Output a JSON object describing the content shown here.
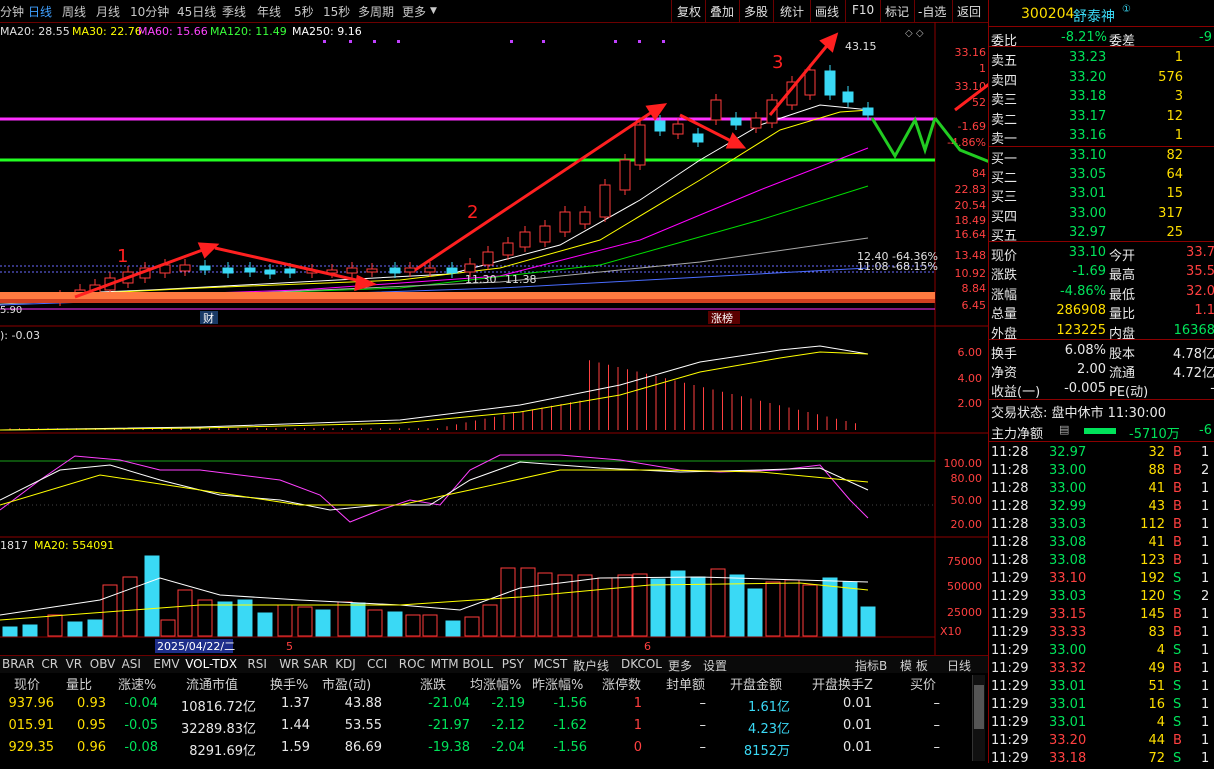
{
  "toolbar": {
    "periods": [
      "分钟",
      "日线",
      "周线",
      "月线",
      "10分钟",
      "45日线",
      "季线",
      "年线",
      "5秒",
      "15秒",
      "多周期",
      "更多"
    ],
    "selected": "日线",
    "actions": [
      "复权",
      "叠加",
      "多股",
      "统计",
      "画线",
      "F10",
      "标记",
      "-自选",
      "返回"
    ]
  },
  "ma_legend": {
    "ma20": "MA20: 28.55",
    "ma30": "MA30: 22.76",
    "ma60": "MA60: 15.66",
    "ma120": "MA120: 11.49",
    "ma250": "MA250: 9.16"
  },
  "price_axis": [
    "33.16",
    "33.10",
    "-1.69",
    "-4.86%",
    "22.83",
    "20.54",
    "18.49",
    "16.64",
    "13.48",
    "10.92",
    "8.84",
    "6.45"
  ],
  "price_axis_extra": [
    "1",
    "52",
    "84"
  ],
  "annotations": {
    "high": "43.15",
    "low": "5.90",
    "mid_low": "11.30",
    "mid_low2": "11.38",
    "pct1": "12.40 -64.36%",
    "pct2": "11.08 -68.15%",
    "label_1": "1",
    "label_2": "2",
    "label_3": "3",
    "tag_cai": "财",
    "tag_zhangbang": "涨榜"
  },
  "indicator1": {
    "label": "): -0.03",
    "axis": [
      "6.00",
      "4.00",
      "2.00"
    ]
  },
  "indicator2": {
    "axis": [
      "100.00",
      "80.00",
      "50.00",
      "20.00"
    ]
  },
  "volume": {
    "label": "1817",
    "ma20": "MA20: 554091",
    "axis": [
      "75000",
      "50000",
      "25000"
    ],
    "x10": "X10",
    "date_label": "2025/04/22/二",
    "month5": "5",
    "month6": "6"
  },
  "stock": {
    "code": "300204",
    "name": "舒泰神"
  },
  "orderbook": {
    "weibi_label": "委比",
    "weibi": "-8.21%",
    "weicha_label": "委差",
    "weicha": "-9",
    "asks": [
      {
        "label": "卖五",
        "price": "33.23",
        "vol": "1"
      },
      {
        "label": "卖四",
        "price": "33.20",
        "vol": "576"
      },
      {
        "label": "卖三",
        "price": "33.18",
        "vol": "3"
      },
      {
        "label": "卖二",
        "price": "33.17",
        "vol": "12"
      },
      {
        "label": "卖一",
        "price": "33.16",
        "vol": "1"
      }
    ],
    "bids": [
      {
        "label": "买一",
        "price": "33.10",
        "vol": "82"
      },
      {
        "label": "买二",
        "price": "33.05",
        "vol": "64"
      },
      {
        "label": "买三",
        "price": "33.01",
        "vol": "15"
      },
      {
        "label": "买四",
        "price": "33.00",
        "vol": "317"
      },
      {
        "label": "买五",
        "price": "32.97",
        "vol": "25"
      }
    ]
  },
  "quote": [
    {
      "l1": "现价",
      "v1": "33.10",
      "l2": "今开",
      "v2": "33.7"
    },
    {
      "l1": "涨跌",
      "v1": "-1.69",
      "l2": "最高",
      "v2": "35.5"
    },
    {
      "l1": "涨幅",
      "v1": "-4.86%",
      "l2": "最低",
      "v2": "32.0"
    },
    {
      "l1": "总量",
      "v1": "286908",
      "l2": "量比",
      "v2": "1.1"
    },
    {
      "l1": "外盘",
      "v1": "123225",
      "l2": "内盘",
      "v2": "16368"
    }
  ],
  "fundamentals": [
    {
      "l1": "换手",
      "v1": "6.08%",
      "l2": "股本",
      "v2": "4.78亿"
    },
    {
      "l1": "净资",
      "v1": "2.00",
      "l2": "流通",
      "v2": "4.72亿"
    },
    {
      "l1": "收益(一)",
      "v1": "-0.005",
      "l2": "PE(动)",
      "v2": "-"
    }
  ],
  "trade_status": "交易状态: 盘中休市 11:30:00",
  "main_flow": {
    "label": "主力净额",
    "value": "-5710万",
    "pct": "-6"
  },
  "ticks": [
    {
      "t": "11:28",
      "p": "32.97",
      "v": "32",
      "d": "B",
      "n": "1"
    },
    {
      "t": "11:28",
      "p": "33.00",
      "v": "88",
      "d": "B",
      "n": "2"
    },
    {
      "t": "11:28",
      "p": "33.00",
      "v": "41",
      "d": "B",
      "n": "1"
    },
    {
      "t": "11:28",
      "p": "32.99",
      "v": "43",
      "d": "B",
      "n": "1"
    },
    {
      "t": "11:28",
      "p": "33.03",
      "v": "112",
      "d": "B",
      "n": "1"
    },
    {
      "t": "11:28",
      "p": "33.08",
      "v": "41",
      "d": "B",
      "n": "1"
    },
    {
      "t": "11:28",
      "p": "33.08",
      "v": "123",
      "d": "B",
      "n": "1"
    },
    {
      "t": "11:29",
      "p": "33.10",
      "v": "192",
      "d": "S",
      "n": "1"
    },
    {
      "t": "11:29",
      "p": "33.03",
      "v": "120",
      "d": "S",
      "n": "2"
    },
    {
      "t": "11:29",
      "p": "33.15",
      "v": "145",
      "d": "B",
      "n": "1"
    },
    {
      "t": "11:29",
      "p": "33.33",
      "v": "83",
      "d": "B",
      "n": "1"
    },
    {
      "t": "11:29",
      "p": "33.00",
      "v": "4",
      "d": "S",
      "n": "1"
    },
    {
      "t": "11:29",
      "p": "33.32",
      "v": "49",
      "d": "B",
      "n": "1"
    },
    {
      "t": "11:29",
      "p": "33.01",
      "v": "51",
      "d": "S",
      "n": "1"
    },
    {
      "t": "11:29",
      "p": "33.01",
      "v": "16",
      "d": "S",
      "n": "1"
    },
    {
      "t": "11:29",
      "p": "33.01",
      "v": "4",
      "d": "S",
      "n": "1"
    },
    {
      "t": "11:29",
      "p": "33.20",
      "v": "44",
      "d": "B",
      "n": "1"
    },
    {
      "t": "11:29",
      "p": "33.18",
      "v": "72",
      "d": "S",
      "n": "1"
    }
  ],
  "indicator_tabs": [
    "BRAR",
    "CR",
    "VR",
    "OBV",
    "ASI",
    "EMV",
    "VOL-TDX",
    "RSI",
    "WR",
    "SAR",
    "KDJ",
    "CCI",
    "ROC",
    "MTM",
    "BOLL",
    "PSY",
    "MCST",
    "散户线",
    "DKCOL",
    "更多",
    "设置"
  ],
  "indicator_tabs_right": [
    "指标B",
    "模 板",
    "日线"
  ],
  "table": {
    "headers": [
      "现价",
      "量比",
      "涨速%",
      "流通市值",
      "换手%",
      "市盈(动)",
      "涨跌",
      "均涨幅%",
      "昨涨幅%",
      "涨停数",
      "封单额",
      "开盘金额",
      "开盘换手Z",
      "买价"
    ],
    "rows": [
      [
        "937.96",
        "0.93",
        "-0.04",
        "10816.72亿",
        "1.37",
        "43.88",
        "-21.04",
        "-2.19",
        "-1.56",
        "1",
        "–",
        "1.61亿",
        "0.01",
        "–"
      ],
      [
        "015.91",
        "0.95",
        "-0.05",
        "32289.83亿",
        "1.44",
        "53.55",
        "-21.97",
        "-2.12",
        "-1.62",
        "1",
        "–",
        "4.23亿",
        "0.01",
        "–"
      ],
      [
        "929.35",
        "0.96",
        "-0.08",
        "8291.69亿",
        "1.59",
        "86.69",
        "-19.38",
        "-2.04",
        "-1.56",
        "0",
        "–",
        "8152万",
        "0.01",
        "–"
      ]
    ]
  },
  "colors": {
    "up": "#ff3c3c",
    "down": "#3ad9f5",
    "ma_white": "#ffffff",
    "ma_yellow": "#ffff00",
    "ma_purple": "#ff00ff",
    "ma_green": "#00ff00",
    "ma_blue": "#4a6cff"
  }
}
